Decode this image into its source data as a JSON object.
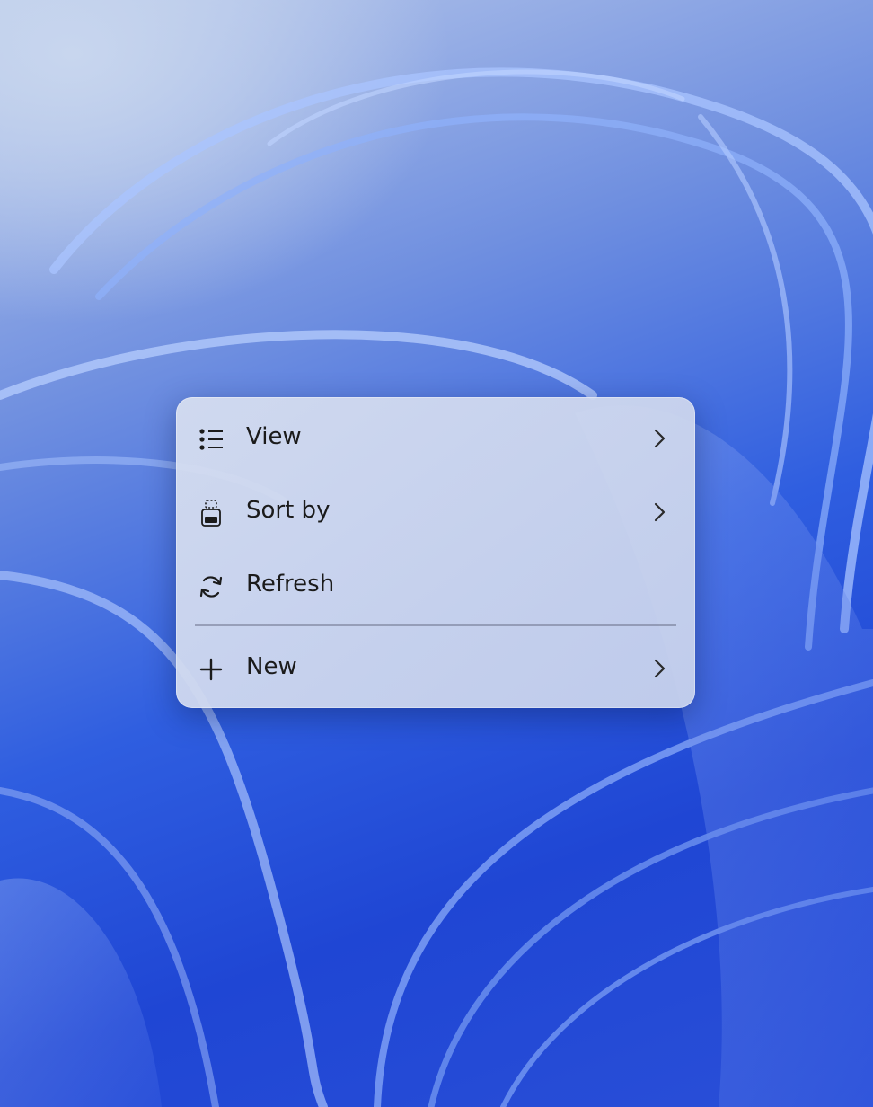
{
  "menu": {
    "items": [
      {
        "label": "View",
        "icon": "list-view-icon",
        "has_submenu": true
      },
      {
        "label": "Sort by",
        "icon": "sort-icon",
        "has_submenu": true
      },
      {
        "label": "Refresh",
        "icon": "refresh-icon",
        "has_submenu": false
      },
      {
        "label": "New",
        "icon": "plus-icon",
        "has_submenu": true
      }
    ]
  },
  "colors": {
    "menu_background": "#cfd8ef",
    "text": "#1b1b1b",
    "wallpaper_blue": "#2f5ee0"
  }
}
